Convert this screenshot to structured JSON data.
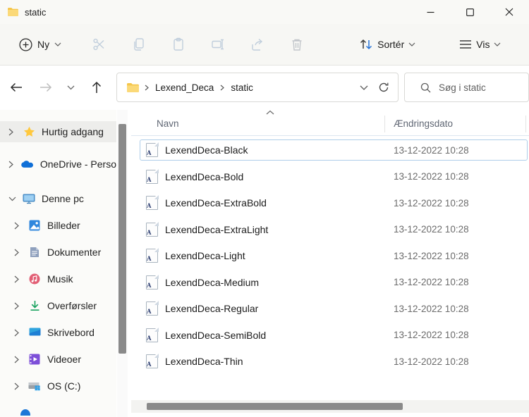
{
  "window": {
    "title": "static"
  },
  "toolbar": {
    "new_label": "Ny",
    "sort_label": "Sortér",
    "view_label": "Vis",
    "icons": [
      "new",
      "cut",
      "copy",
      "paste",
      "rename",
      "share",
      "delete",
      "sort",
      "view",
      "more"
    ]
  },
  "navbar": {
    "breadcrumb": [
      "Lexend_Deca",
      "static"
    ],
    "search_placeholder": "Søg i static"
  },
  "sidebar": {
    "items": [
      {
        "label": "Hurtig adgang",
        "icon": "star-icon",
        "selected": true
      },
      {
        "label": "OneDrive - Perso",
        "icon": "onedrive-icon",
        "selected": false
      },
      {
        "label": "Denne pc",
        "icon": "this-pc-icon",
        "selected": false
      },
      {
        "label": "Billeder",
        "icon": "pictures-icon",
        "selected": false
      },
      {
        "label": "Dokumenter",
        "icon": "documents-icon",
        "selected": false
      },
      {
        "label": "Musik",
        "icon": "music-icon",
        "selected": false
      },
      {
        "label": "Overførsler",
        "icon": "downloads-icon",
        "selected": false
      },
      {
        "label": "Skrivebord",
        "icon": "desktop-icon",
        "selected": false
      },
      {
        "label": "Videoer",
        "icon": "videos-icon",
        "selected": false
      },
      {
        "label": "OS (C:)",
        "icon": "drive-icon",
        "selected": false
      }
    ]
  },
  "files": {
    "columns": [
      "Navn",
      "Ændringsdato"
    ],
    "rows": [
      {
        "name": "LexendDeca-Black",
        "modified": "13-12-2022 10:28"
      },
      {
        "name": "LexendDeca-Bold",
        "modified": "13-12-2022 10:28"
      },
      {
        "name": "LexendDeca-ExtraBold",
        "modified": "13-12-2022 10:28"
      },
      {
        "name": "LexendDeca-ExtraLight",
        "modified": "13-12-2022 10:28"
      },
      {
        "name": "LexendDeca-Light",
        "modified": "13-12-2022 10:28"
      },
      {
        "name": "LexendDeca-Medium",
        "modified": "13-12-2022 10:28"
      },
      {
        "name": "LexendDeca-Regular",
        "modified": "13-12-2022 10:28"
      },
      {
        "name": "LexendDeca-SemiBold",
        "modified": "13-12-2022 10:28"
      },
      {
        "name": "LexendDeca-Thin",
        "modified": "13-12-2022 10:28"
      }
    ]
  },
  "colors": {
    "folder_yellow": "#f5c64b",
    "sort_arrow_blue": "#2472d8",
    "disabled_icon": "#c0cedc",
    "selection_border": "#aecde9",
    "scrollbar_thumb": "#8a8a8a"
  }
}
